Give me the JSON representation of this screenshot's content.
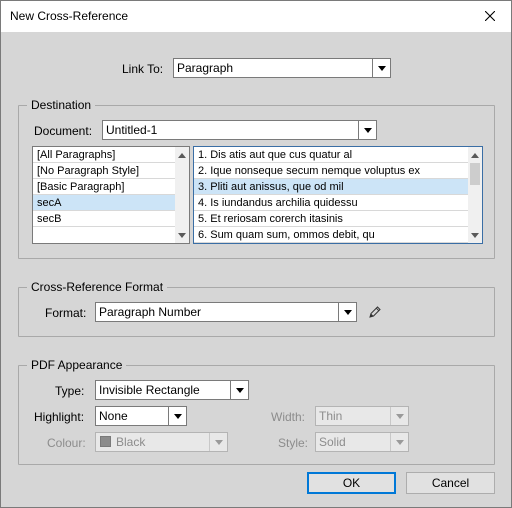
{
  "window": {
    "title": "New Cross-Reference",
    "close_icon": "close-icon"
  },
  "link_to": {
    "label": "Link To:",
    "value": "Paragraph"
  },
  "destination": {
    "group_title": "Destination",
    "document_label": "Document:",
    "document_value": "Untitled-1",
    "styles": [
      "[All Paragraphs]",
      "[No Paragraph Style]",
      "[Basic Paragraph]",
      "secA",
      "secB"
    ],
    "styles_selected_index": 3,
    "paragraphs": [
      "1. Dis atis aut que cus quatur al",
      "2. Ique nonseque secum nemque voluptus ex",
      "3. Pliti aut anissus, que od mil",
      "4. Is iundandus archilia quidessu",
      "5. Et reriosam corerch itasinis",
      "6. Sum quam sum, ommos debit, qu"
    ],
    "paragraphs_selected_index": 2
  },
  "format_section": {
    "group_title": "Cross-Reference Format",
    "format_label": "Format:",
    "format_value": "Paragraph Number",
    "edit_icon": "pencil-icon"
  },
  "pdf": {
    "group_title": "PDF Appearance",
    "type_label": "Type:",
    "type_value": "Invisible Rectangle",
    "highlight_label": "Highlight:",
    "highlight_value": "None",
    "width_label": "Width:",
    "width_value": "Thin",
    "colour_label": "Colour:",
    "colour_value": "Black",
    "style_label": "Style:",
    "style_value": "Solid"
  },
  "buttons": {
    "ok": "OK",
    "cancel": "Cancel"
  }
}
